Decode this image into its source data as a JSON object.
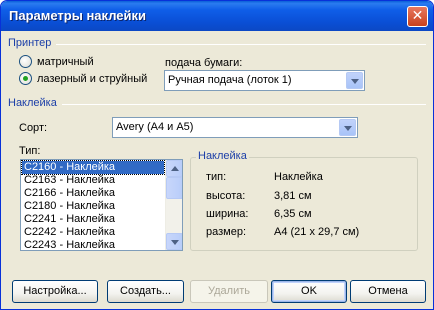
{
  "window": {
    "title": "Параметры наклейки"
  },
  "printer": {
    "section_label": "Принтер",
    "radio_dotmatrix": "матричный",
    "radio_laser": "лазерный и струйный",
    "selected": "laser",
    "feed_label": "подача бумаги:",
    "feed_value": "Ручная подача (лоток 1)"
  },
  "label_section": {
    "section_label": "Наклейка",
    "sort_label": "Сорт:",
    "sort_value": "Avery (A4 и A5)",
    "type_label": "Тип:",
    "types": [
      "C2160 - Наклейка",
      "C2163 - Наклейка",
      "C2166 - Наклейка",
      "C2180 - Наклейка",
      "C2241 - Наклейка",
      "C2242 - Наклейка",
      "C2243 - Наклейка"
    ],
    "selected_index": 0
  },
  "details": {
    "title": "Наклейка",
    "rows": [
      {
        "key": "тип:",
        "value": "Наклейка"
      },
      {
        "key": "высота:",
        "value": "3,81 см"
      },
      {
        "key": "ширина:",
        "value": "6,35 см"
      },
      {
        "key": "размер:",
        "value": "A4 (21 x 29,7 см)"
      }
    ]
  },
  "buttons": {
    "setup": "Настройка...",
    "create": "Создать...",
    "delete": "Удалить",
    "ok": "OK",
    "cancel": "Отмена"
  },
  "colors": {
    "title_bar": "#0a4fd6",
    "section_label": "#1c3fa8",
    "selection": "#316ac5",
    "face": "#ece9d8"
  }
}
